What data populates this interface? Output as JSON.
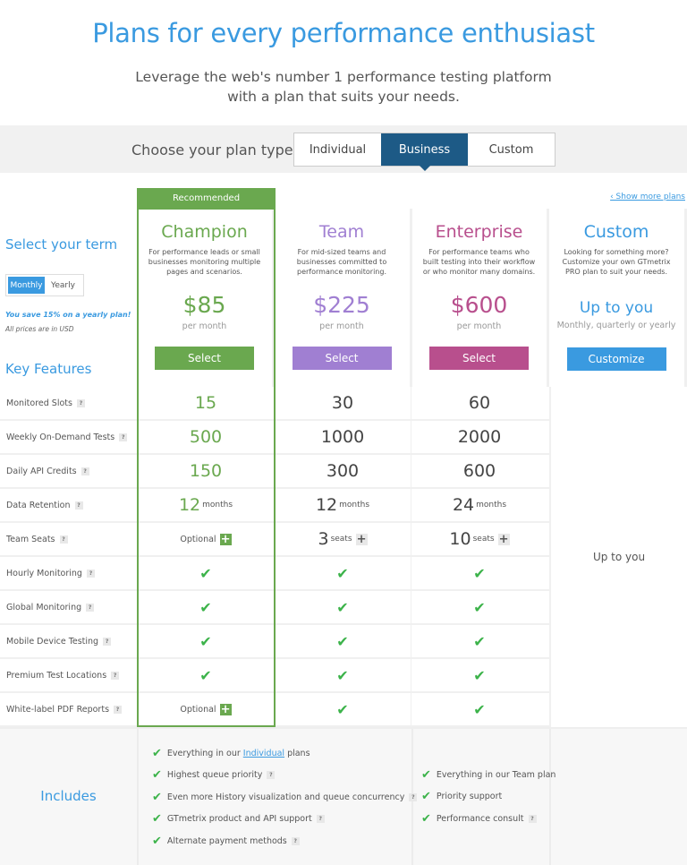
{
  "header": {
    "title": "Plans for every performance enthusiast",
    "subtitle": "Leverage the web's number 1 performance testing platform with a plan that suits your needs."
  },
  "plan_type": {
    "label": "Choose your plan type",
    "options": [
      "Individual",
      "Business",
      "Custom"
    ],
    "selected": "Business"
  },
  "show_more": "‹ Show more plans",
  "recommended": "Recommended",
  "term": {
    "heading": "Select your term",
    "options": [
      "Monthly",
      "Yearly"
    ],
    "selected": "Monthly",
    "save_note": "You save 15% on a yearly plan!",
    "currency_note": "All prices are in USD"
  },
  "key_features_heading": "Key Features",
  "plans": [
    {
      "name": "Champion",
      "color": "#6aa84f",
      "desc": "For performance leads or small businesses monitoring multiple pages and scenarios.",
      "price": "$85",
      "period": "per month",
      "button": "Select"
    },
    {
      "name": "Team",
      "color": "#a07fd2",
      "desc": "For mid-sized teams and businesses committed to performance monitoring.",
      "price": "$225",
      "period": "per month",
      "button": "Select"
    },
    {
      "name": "Enterprise",
      "color": "#b84f8d",
      "desc": "For performance teams who built testing into their workflow or who monitor many domains.",
      "price": "$600",
      "period": "per month",
      "button": "Select"
    },
    {
      "name": "Custom",
      "color": "#3a9ae0",
      "desc": "Looking for something more? Customize your own GTmetrix PRO plan to suit your needs.",
      "price": "Up to you",
      "period": "Monthly, quarterly or yearly",
      "button": "Customize"
    }
  ],
  "features": [
    {
      "label": "Monitored Slots",
      "values": [
        "15",
        "30",
        "60"
      ]
    },
    {
      "label": "Weekly On-Demand Tests",
      "values": [
        "500",
        "1000",
        "2000"
      ]
    },
    {
      "label": "Daily API Credits",
      "values": [
        "150",
        "300",
        "600"
      ]
    },
    {
      "label": "Data Retention",
      "values": [
        "12",
        "12",
        "24"
      ],
      "unit": "months"
    },
    {
      "label": "Team Seats",
      "values": [
        "Optional",
        "3",
        "10"
      ],
      "unit": "seats"
    },
    {
      "label": "Hourly Monitoring",
      "values": [
        "check",
        "check",
        "check"
      ]
    },
    {
      "label": "Global Monitoring",
      "values": [
        "check",
        "check",
        "check"
      ]
    },
    {
      "label": "Mobile Device Testing",
      "values": [
        "check",
        "check",
        "check"
      ]
    },
    {
      "label": "Premium Test Locations",
      "values": [
        "check",
        "check",
        "check"
      ]
    },
    {
      "label": "White-label PDF Reports",
      "values": [
        "Optional",
        "check",
        "check"
      ]
    }
  ],
  "custom_features": "Up to you",
  "includes": {
    "heading": "Includes",
    "champion_team": [
      {
        "pre": "Everything in our ",
        "link": "Individual",
        "post": " plans"
      },
      {
        "pre": "Highest queue priority",
        "help": true
      },
      {
        "pre": "Even more History visualization and queue concurrency",
        "help": true
      },
      {
        "pre": "GTmetrix product and API support",
        "help": true
      },
      {
        "pre": "Alternate payment methods",
        "help": true
      }
    ],
    "enterprise": [
      {
        "pre": "Everything in our Team plan"
      },
      {
        "pre": "Priority support"
      },
      {
        "pre": "Performance consult",
        "help": true
      }
    ]
  }
}
